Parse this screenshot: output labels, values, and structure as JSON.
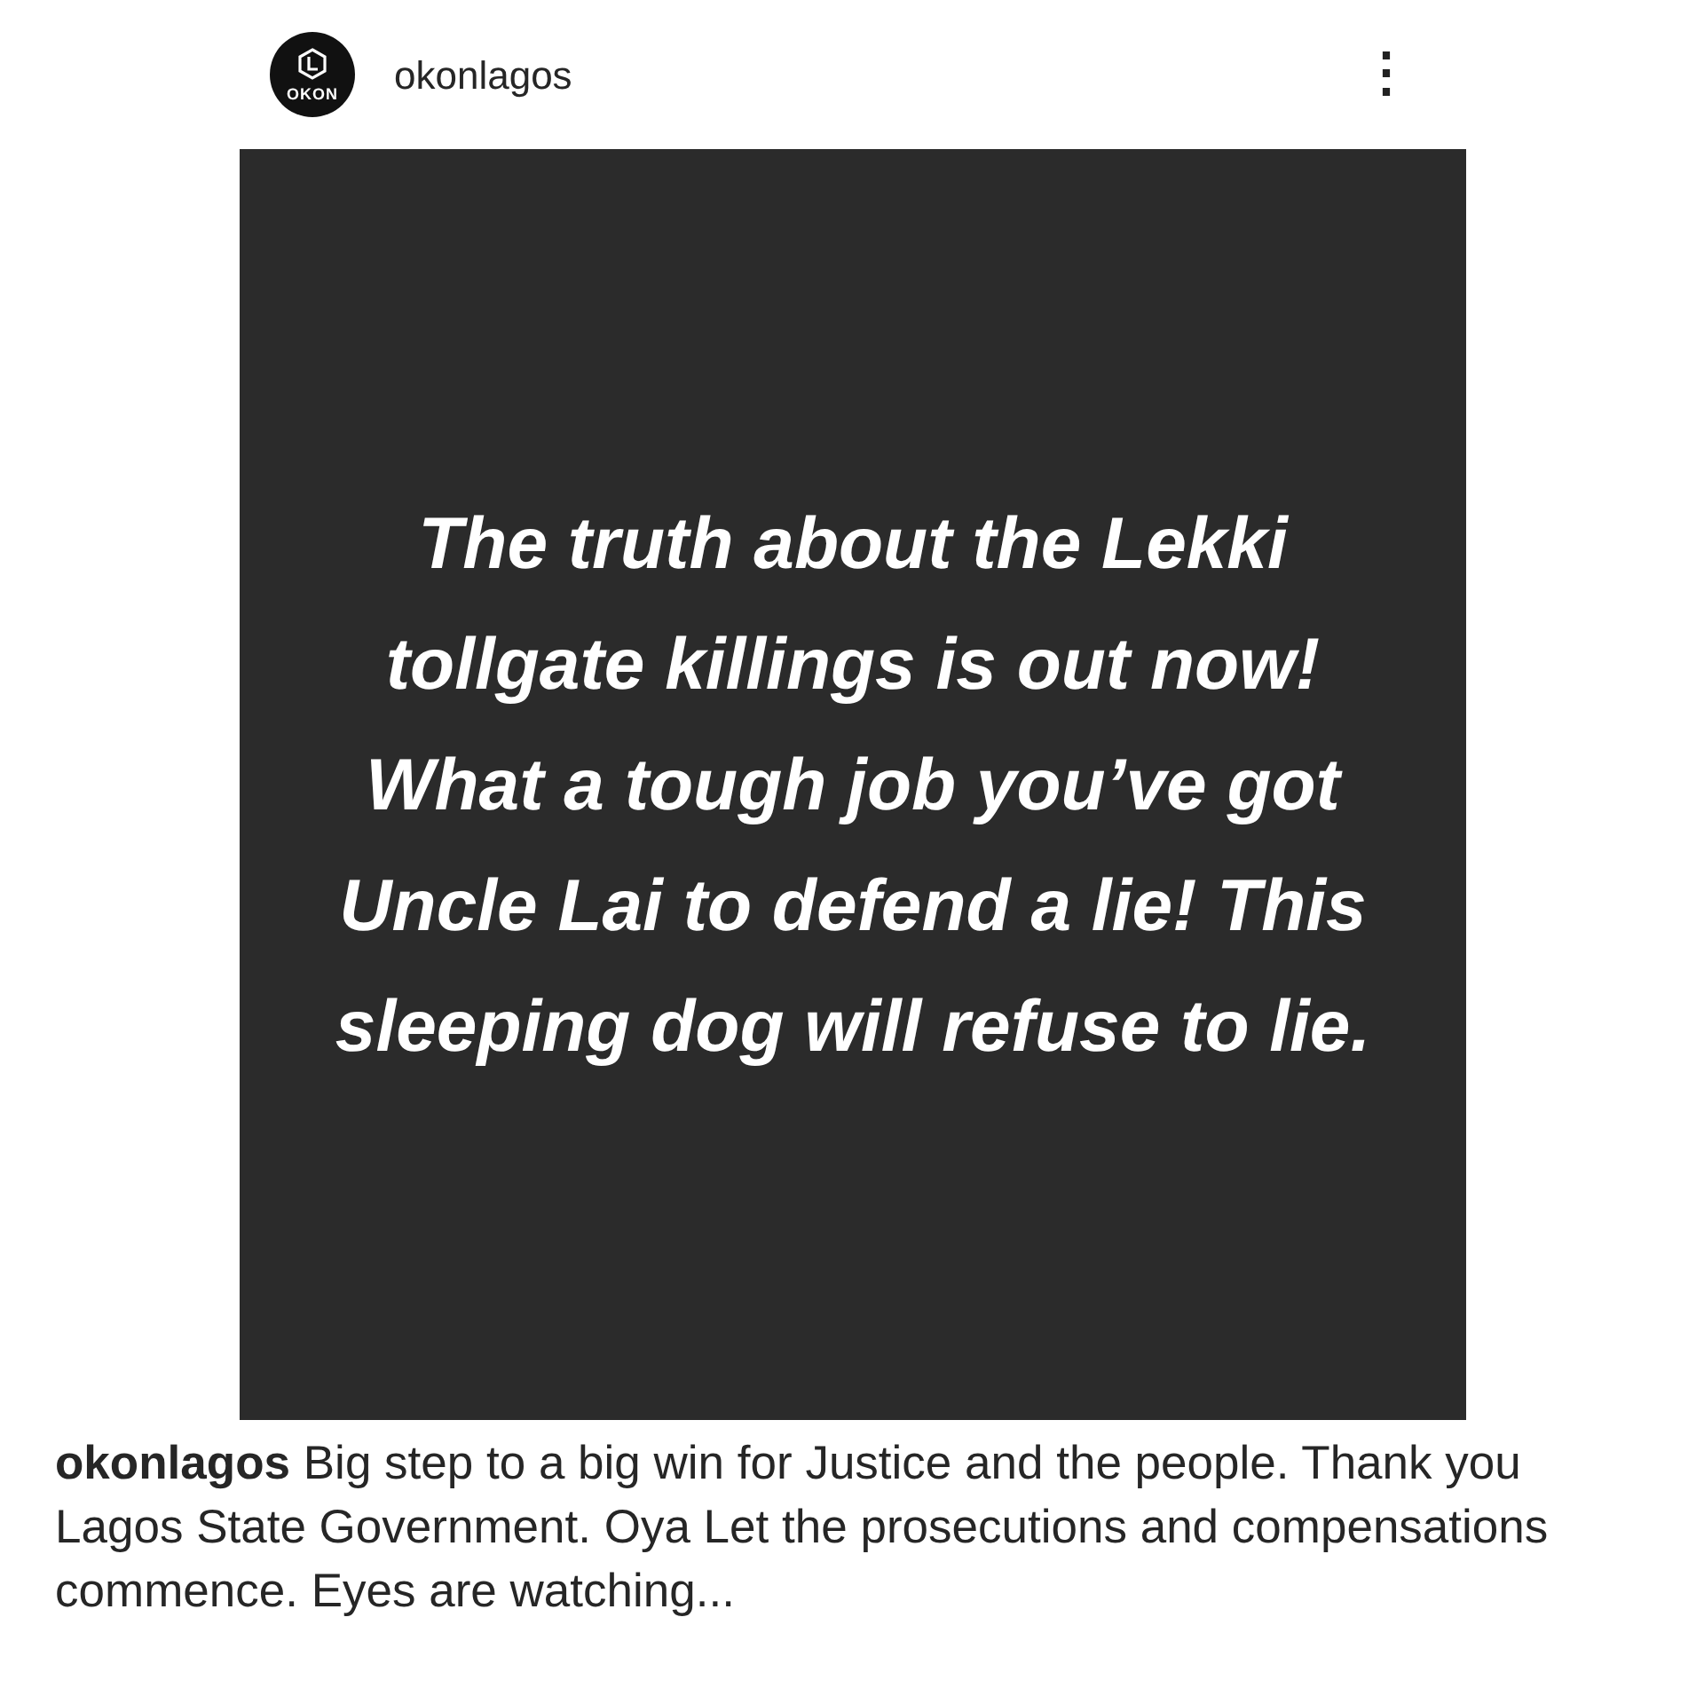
{
  "post": {
    "username": "okonlagos",
    "avatar_text": "OKON",
    "menu_icon": "⋮",
    "image_text": "The truth about the Lekki tollgate killings is out now! What a tough job you’ve got Uncle Lai to defend a lie! This sleeping dog will refuse to lie.",
    "caption": "**okonlagos** Big step to a big win for Justice and the people. Thank you Lagos State Government. Oya Let the prosecutions and compensations commence. Eyes are watching..."
  }
}
